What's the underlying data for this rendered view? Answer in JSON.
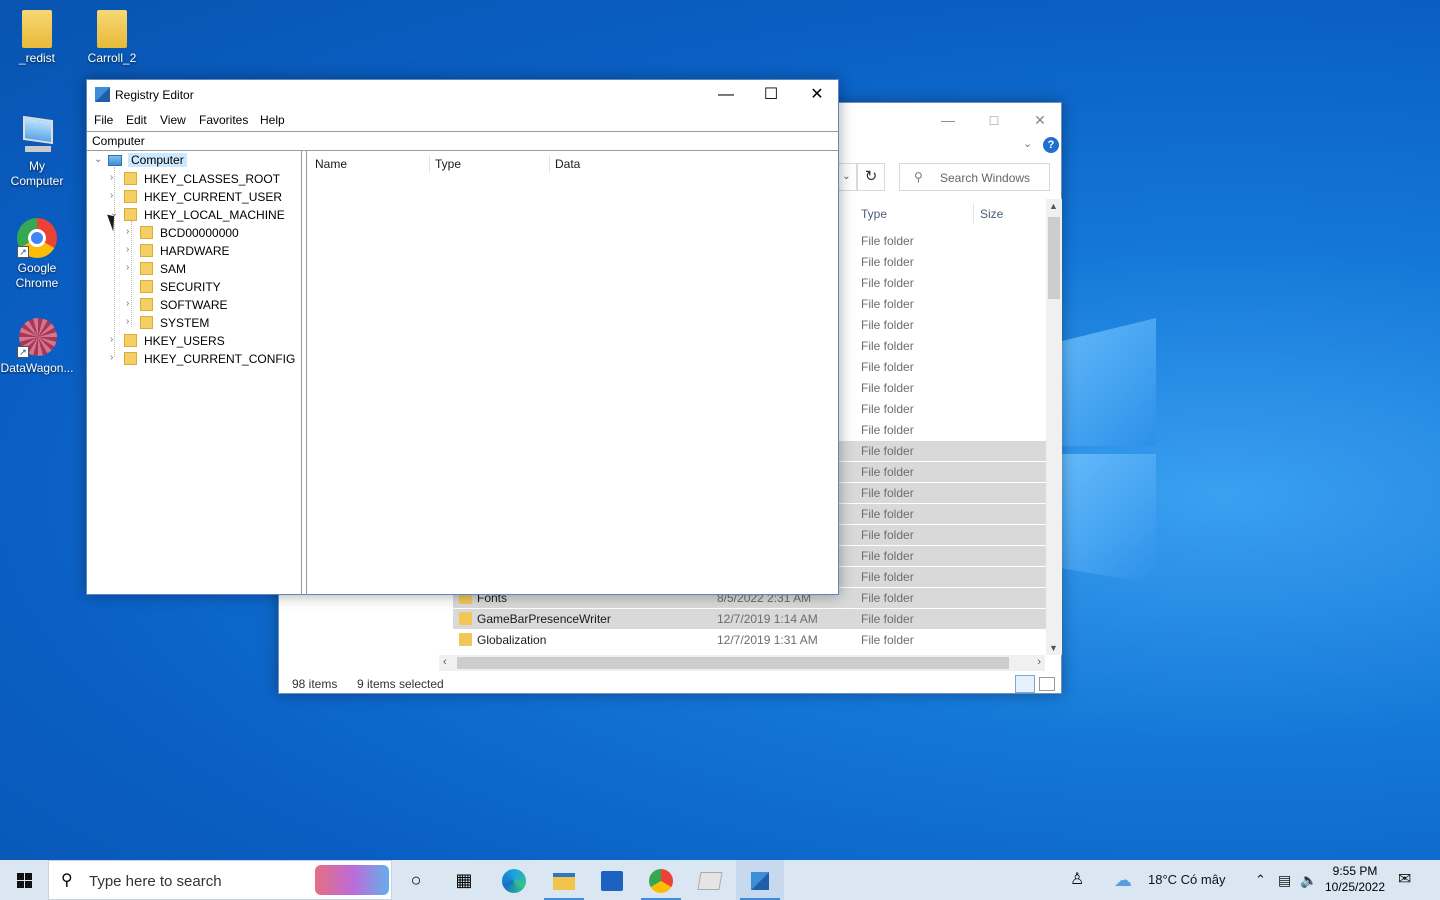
{
  "desktop": {
    "icons": [
      {
        "label": "_redist"
      },
      {
        "label": "Carroll_2"
      },
      {
        "label": "My Computer"
      },
      {
        "label": "Google Chrome"
      },
      {
        "label": "DataWagon..."
      }
    ]
  },
  "explorer": {
    "search_placeholder": "Search Windows",
    "columns": {
      "type": "Type",
      "size": "Size"
    },
    "rows": [
      {
        "name": "",
        "date": "",
        "type": "File folder",
        "selected": false
      },
      {
        "name": "",
        "date": "",
        "type": "File folder",
        "selected": false
      },
      {
        "name": "",
        "date": "",
        "type": "File folder",
        "selected": false
      },
      {
        "name": "",
        "date": "",
        "type": "File folder",
        "selected": false
      },
      {
        "name": "",
        "date": "",
        "type": "File folder",
        "selected": false
      },
      {
        "name": "",
        "date": "",
        "type": "File folder",
        "selected": false
      },
      {
        "name": "",
        "date": "",
        "type": "File folder",
        "selected": false
      },
      {
        "name": "",
        "date": "",
        "type": "File folder",
        "selected": false
      },
      {
        "name": "",
        "date": "",
        "type": "File folder",
        "selected": false
      },
      {
        "name": "",
        "date": "",
        "type": "File folder",
        "selected": false
      },
      {
        "name": "",
        "date": "",
        "type": "File folder",
        "selected": true
      },
      {
        "name": "",
        "date": "",
        "type": "File folder",
        "selected": true
      },
      {
        "name": "",
        "date": "",
        "type": "File folder",
        "selected": true
      },
      {
        "name": "",
        "date": "",
        "type": "File folder",
        "selected": true
      },
      {
        "name": "",
        "date": "",
        "type": "File folder",
        "selected": true
      },
      {
        "name": "",
        "date": "",
        "type": "File folder",
        "selected": true
      },
      {
        "name": "",
        "date": "",
        "type": "File folder",
        "selected": true
      },
      {
        "name": "Fonts",
        "date": "8/5/2022 2:31 AM",
        "type": "File folder",
        "selected": true
      },
      {
        "name": "GameBarPresenceWriter",
        "date": "12/7/2019 1:14 AM",
        "type": "File folder",
        "selected": true
      },
      {
        "name": "Globalization",
        "date": "12/7/2019 1:31 AM",
        "type": "File folder",
        "selected": false
      }
    ],
    "status": {
      "items": "98 items",
      "selected": "9 items selected"
    }
  },
  "regedit": {
    "title": "Registry Editor",
    "menu": [
      "File",
      "Edit",
      "View",
      "Favorites",
      "Help"
    ],
    "address": "Computer",
    "tree": {
      "root": "Computer",
      "hives": [
        "HKEY_CLASSES_ROOT",
        "HKEY_CURRENT_USER",
        "HKEY_LOCAL_MACHINE",
        "HKEY_USERS",
        "HKEY_CURRENT_CONFIG"
      ],
      "hklm_children": [
        "BCD00000000",
        "HARDWARE",
        "SAM",
        "SECURITY",
        "SOFTWARE",
        "SYSTEM"
      ]
    },
    "columns": [
      "Name",
      "Type",
      "Data"
    ]
  },
  "taskbar": {
    "search_placeholder": "Type here to search",
    "weather": "18°C  Có mây",
    "time": "9:55 PM",
    "date": "10/25/2022"
  },
  "colors": {
    "desktop": "#0a5fc4",
    "selection": "#cce8ff",
    "taskbar": "#dbe6f3"
  }
}
